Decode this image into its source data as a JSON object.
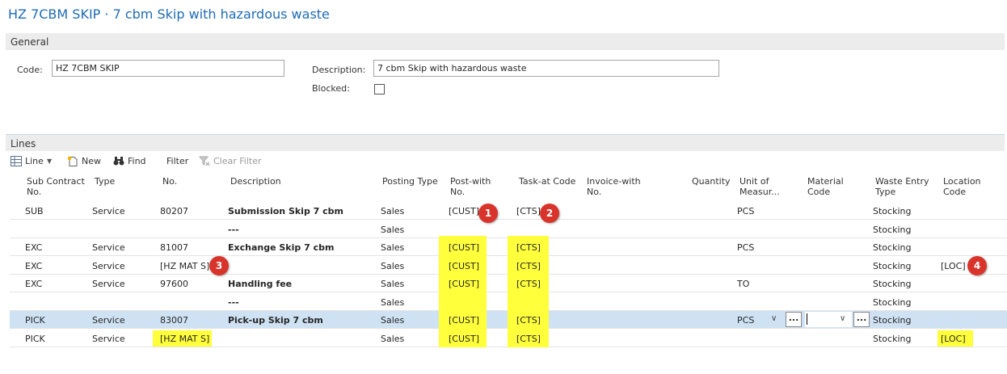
{
  "page_title": "HZ 7CBM SKIP · 7 cbm Skip with hazardous waste",
  "general": {
    "section_label": "General",
    "code_label": "Code:",
    "code_value": "HZ 7CBM SKIP",
    "description_label": "Description:",
    "description_value": "7 cbm Skip with hazardous waste",
    "blocked_label": "Blocked:",
    "blocked_checked": false
  },
  "lines": {
    "section_label": "Lines",
    "toolbar": {
      "line_label": "Line",
      "new_label": "New",
      "find_label": "Find",
      "filter_label": "Filter",
      "clear_filter_label": "Clear Filter"
    },
    "columns": {
      "sub_contract_no": [
        "Sub Contract",
        "No."
      ],
      "type": [
        "Type"
      ],
      "no": [
        "No."
      ],
      "description": [
        "Description"
      ],
      "posting_type": [
        "Posting Type"
      ],
      "post_with_no": [
        "Post-with",
        "No."
      ],
      "task_at_code": [
        "Task-at Code"
      ],
      "invoice_with_no": [
        "Invoice-with",
        "No."
      ],
      "quantity": [
        "Quantity"
      ],
      "unit_of_measure": [
        "Unit of",
        "Measur..."
      ],
      "material_code": [
        "Material",
        "Code"
      ],
      "waste_entry_type": [
        "Waste Entry",
        "Type"
      ],
      "location_code": [
        "Location",
        "Code"
      ]
    },
    "rows": [
      {
        "sub": "SUB",
        "type": "Service",
        "no": "80207",
        "desc": "Submission Skip 7 cbm",
        "posting": "Sales",
        "post_with": "[CUST]",
        "task_at": "[CTS]",
        "uom": "PCS",
        "waste": "Stocking",
        "location": ""
      },
      {
        "sub": "",
        "type": "",
        "no": "",
        "desc": "---",
        "posting": "Sales",
        "post_with": "",
        "task_at": "",
        "uom": "",
        "waste": "Stocking",
        "location": ""
      },
      {
        "sub": "EXC",
        "type": "Service",
        "no": "81007",
        "desc": "Exchange Skip 7 cbm",
        "posting": "Sales",
        "post_with": "[CUST]",
        "task_at": "[CTS]",
        "uom": "PCS",
        "waste": "Stocking",
        "location": ""
      },
      {
        "sub": "EXC",
        "type": "Service",
        "no": "[HZ MAT S]",
        "desc": "",
        "posting": "Sales",
        "post_with": "[CUST]",
        "task_at": "[CTS]",
        "uom": "",
        "waste": "Stocking",
        "location": "[LOC]"
      },
      {
        "sub": "EXC",
        "type": "Service",
        "no": "97600",
        "desc": "Handling fee",
        "posting": "Sales",
        "post_with": "[CUST]",
        "task_at": "[CTS]",
        "uom": "TO",
        "waste": "Stocking",
        "location": ""
      },
      {
        "sub": "",
        "type": "",
        "no": "",
        "desc": "---",
        "posting": "Sales",
        "post_with": "",
        "task_at": "",
        "uom": "",
        "waste": "Stocking",
        "location": ""
      },
      {
        "sub": "PICK",
        "type": "Service",
        "no": "83007",
        "desc": "Pick-up Skip 7 cbm",
        "posting": "Sales",
        "post_with": "[CUST]",
        "task_at": "[CTS]",
        "uom": "PCS",
        "waste": "Stocking",
        "location": ""
      },
      {
        "sub": "PICK",
        "type": "Service",
        "no": "[HZ MAT S]",
        "desc": "",
        "posting": "Sales",
        "post_with": "[CUST]",
        "task_at": "[CTS]",
        "uom": "",
        "waste": "Stocking",
        "location": "[LOC]"
      }
    ],
    "selected_row_index": 6,
    "selected_row_ellipsis": "..."
  },
  "annotations": [
    "1",
    "2",
    "3",
    "4"
  ],
  "colors": {
    "title": "#1f6bb5",
    "highlight": "#ffff3c",
    "selected_row": "#cfe2f3",
    "badge": "#d9342b"
  }
}
